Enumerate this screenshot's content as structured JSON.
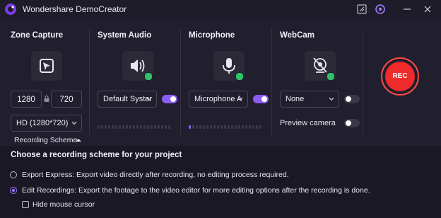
{
  "window": {
    "title": "Wondershare DemoCreator"
  },
  "capture": {
    "zone": {
      "title": "Zone Capture",
      "width": "1280",
      "height": "720",
      "resolution": "HD (1280*720)"
    },
    "system_audio": {
      "title": "System Audio",
      "device": "Default Syster",
      "enabled": true
    },
    "microphone": {
      "title": "Microphone",
      "device": "Microphone A",
      "enabled": true
    },
    "webcam": {
      "title": "WebCam",
      "device": "None",
      "enabled": false,
      "preview_label": "Preview camera",
      "preview_enabled": false
    },
    "rec_label": "REC"
  },
  "scheme": {
    "toggle_label": "Recording Scheme",
    "heading": "Choose a recording scheme for your project",
    "options": [
      {
        "label": "Export Express: Export video directly after recording, no editing process required.",
        "selected": false
      },
      {
        "label": "Edit Recordings: Export the footage to the video editor for more editing options after the recording is done.",
        "selected": true
      }
    ],
    "hide_cursor_label": "Hide mouse cursor"
  },
  "colors": {
    "accent": "#8b5cf6",
    "rec": "#ee2a2a",
    "status_ok": "#2ec26a"
  }
}
